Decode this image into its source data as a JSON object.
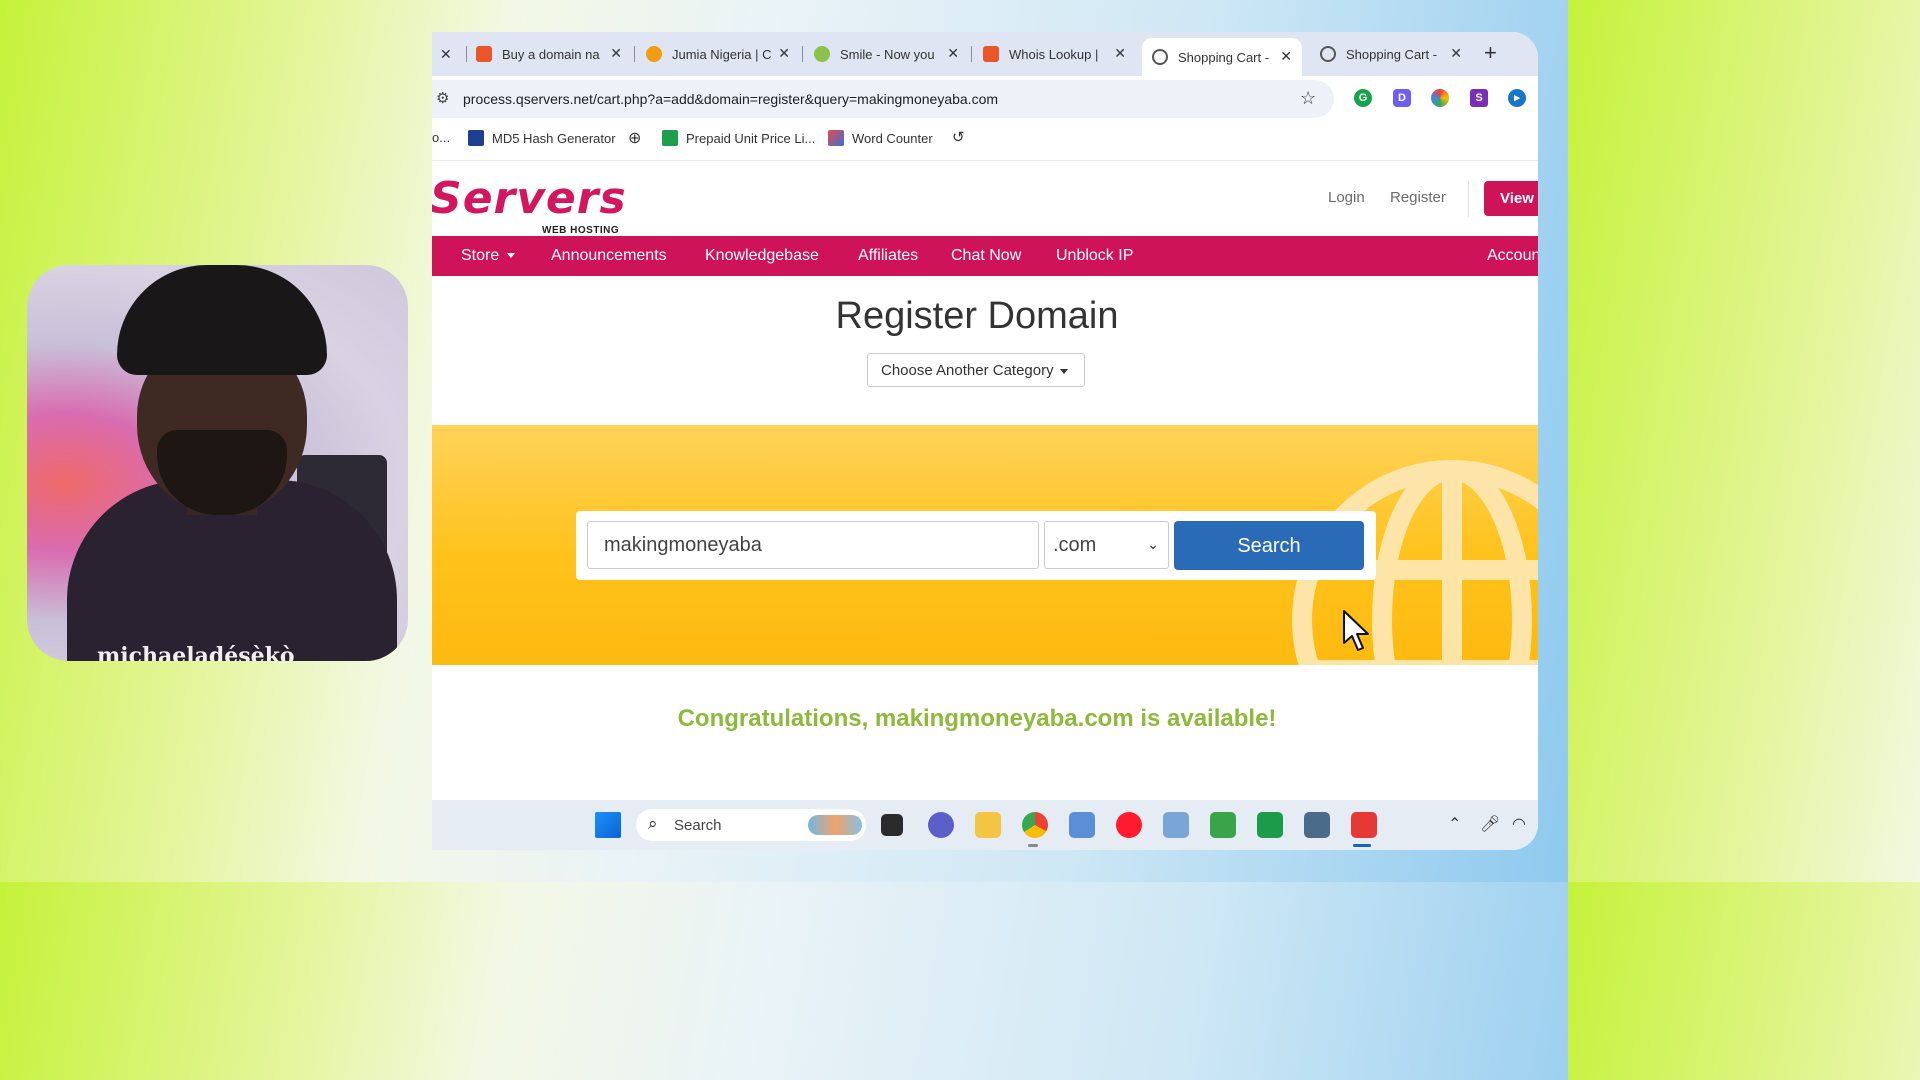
{
  "webcam": {
    "overlay_text": "michaeladéṣèkò"
  },
  "browser": {
    "tabs": [
      {
        "label": "Buy a domain na",
        "color": "#e8562a"
      },
      {
        "label": "Jumia Nigeria | C",
        "color": "#f39c12"
      },
      {
        "label": "Smile - Now you",
        "color": "#8bc34a"
      },
      {
        "label": "Whois Lookup |",
        "color": "#e8562a"
      },
      {
        "label": "Shopping Cart -",
        "color": "#555555",
        "active": true
      },
      {
        "label": "Shopping Cart -",
        "color": "#555555"
      }
    ],
    "new_tab": "+",
    "url": "process.qservers.net/cart.php?a=add&domain=register&query=makingmoneyaba.com",
    "bookmarks": [
      {
        "label": "o..."
      },
      {
        "label": "MD5 Hash Generator"
      },
      {
        "label": "Prepaid Unit Price Li..."
      },
      {
        "label": "Word Counter"
      }
    ]
  },
  "site": {
    "logo_text": "Servers",
    "logo_sub": "WEB HOSTING",
    "login": "Login",
    "register": "Register",
    "view_cart": "View",
    "nav": [
      "Store",
      "Announcements",
      "Knowledgebase",
      "Affiliates",
      "Chat Now",
      "Unblock IP",
      "Accoun"
    ],
    "page_title": "Register Domain",
    "category_button": "Choose Another Category",
    "search": {
      "value": "makingmoneyaba",
      "tld": ".com",
      "button": "Search"
    },
    "result": "Congratulations, makingmoneyaba.com is available!",
    "brand_color": "#cf1359",
    "accent_color": "#2a6bb8",
    "success_color": "#8dba3a"
  },
  "taskbar": {
    "search_label": "Search"
  }
}
